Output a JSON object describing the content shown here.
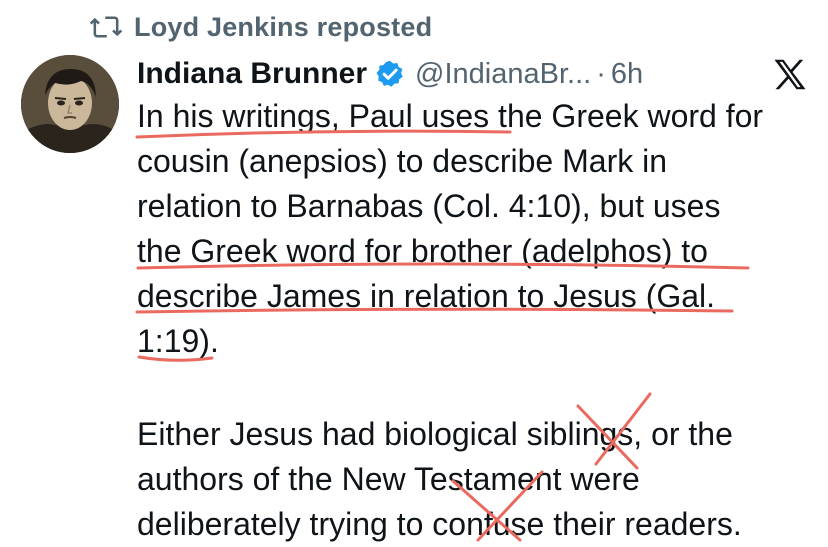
{
  "repost": {
    "icon": "repost-icon",
    "text": "Loyd Jenkins reposted"
  },
  "author": {
    "avatar_icon": "avatar",
    "name": "Indiana Brunner",
    "verified_icon": "verified-badge-icon",
    "handle": "@IndianaBr...",
    "separator": "·",
    "time": "6h",
    "platform_icon": "x-logo-icon"
  },
  "tweet": {
    "lines": [
      "In his writings, Paul uses the Greek word for",
      "cousin (anepsios) to describe Mark in",
      "relation to Barnabas (Col. 4:10), but uses",
      "the Greek word for brother (adelphos) to",
      "describe James in relation to Jesus (Gal.",
      "1:19).",
      "Either Jesus had biological siblings, or the",
      "authors of the New Testament were",
      "deliberately trying to confuse their readers."
    ]
  },
  "annotations": {
    "underline_color": "#ea6a60",
    "cross_color": "#ea6a60",
    "underlined_lines": [
      0,
      3,
      4,
      5
    ],
    "crossed_words": [
      "siblings",
      "confuse"
    ]
  },
  "colors": {
    "text": "#0f1419",
    "secondary": "#536471",
    "verified": "#1d9bf0"
  }
}
